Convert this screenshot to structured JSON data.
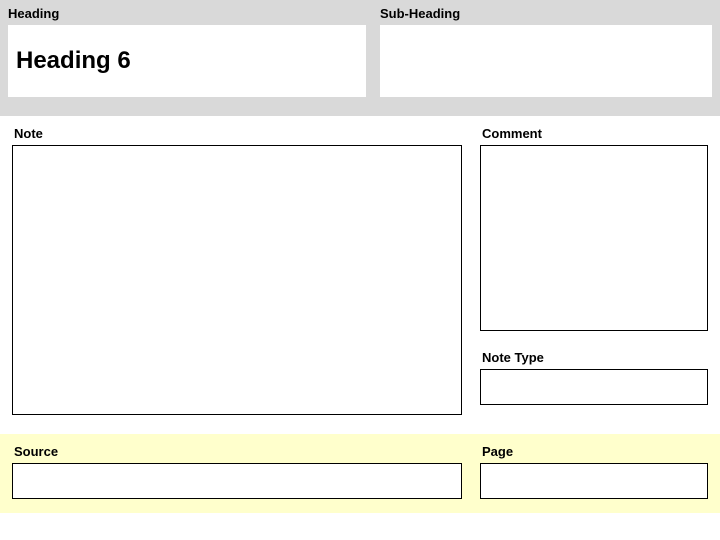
{
  "top": {
    "heading_label": "Heading",
    "heading_value": "Heading 6",
    "subheading_label": "Sub-Heading",
    "subheading_value": ""
  },
  "mid": {
    "note_label": "Note",
    "note_value": "",
    "comment_label": "Comment",
    "comment_value": "",
    "notetype_label": "Note Type",
    "notetype_value": ""
  },
  "bottom": {
    "source_label": "Source",
    "source_value": "",
    "page_label": "Page",
    "page_value": ""
  }
}
